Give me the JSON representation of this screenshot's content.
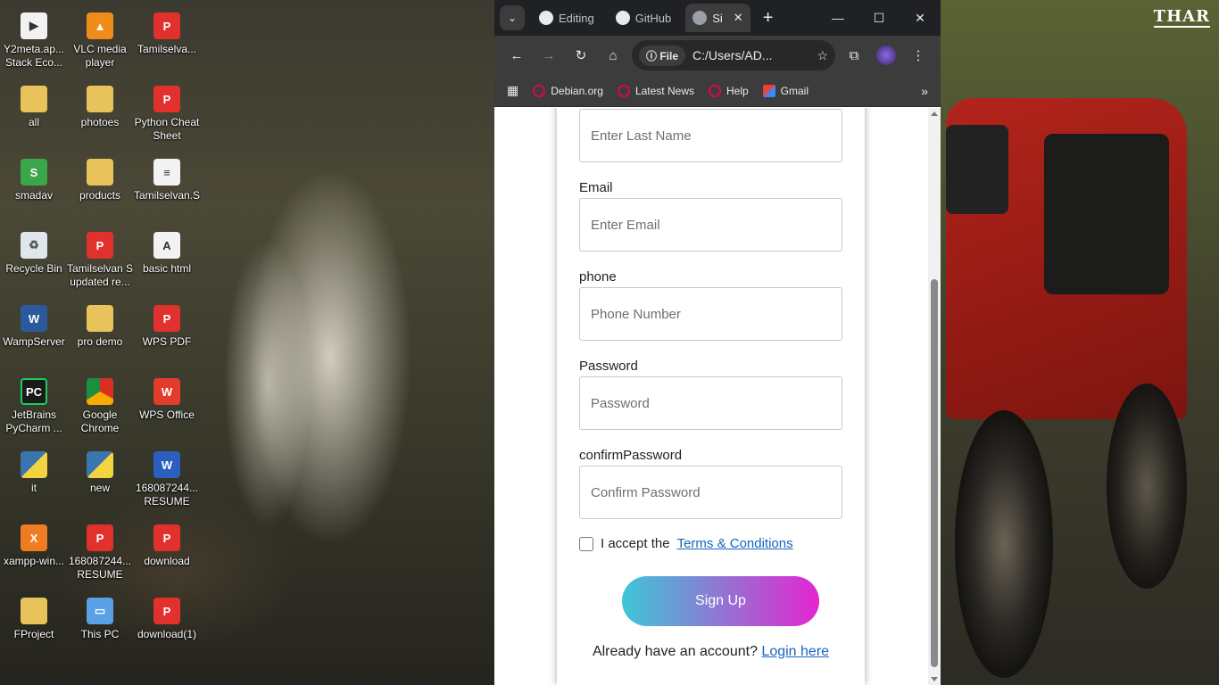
{
  "desktop": {
    "corner_logo": "THAR",
    "icons": [
      {
        "label": "Y2meta.ap... Stack Eco...",
        "icon": "video-file-icon"
      },
      {
        "label": "VLC media player",
        "icon": "vlc-icon"
      },
      {
        "label": "Tamilselva...",
        "icon": "pdf-icon"
      },
      {
        "label": "all",
        "icon": "folder-icon"
      },
      {
        "label": "photoes",
        "icon": "folder-icon"
      },
      {
        "label": "Python Cheat Sheet",
        "icon": "pdf-icon"
      },
      {
        "label": "smadav",
        "icon": "smadav-icon"
      },
      {
        "label": "products",
        "icon": "folder-icon"
      },
      {
        "label": "Tamilselvan.S",
        "icon": "text-file-icon"
      },
      {
        "label": "Recycle Bin",
        "icon": "recycle-bin-icon"
      },
      {
        "label": "Tamilselvan S updated re...",
        "icon": "pdf-icon"
      },
      {
        "label": "basic html",
        "icon": "html-file-icon"
      },
      {
        "label": "WampServer",
        "icon": "wampserver-icon"
      },
      {
        "label": "pro demo",
        "icon": "folder-icon"
      },
      {
        "label": "WPS PDF",
        "icon": "pdf-icon"
      },
      {
        "label": "JetBrains PyCharm ...",
        "icon": "pycharm-icon"
      },
      {
        "label": "Google Chrome",
        "icon": "chrome-icon"
      },
      {
        "label": "WPS Office",
        "icon": "wps-office-icon"
      },
      {
        "label": "it",
        "icon": "python-icon"
      },
      {
        "label": "new",
        "icon": "python-icon"
      },
      {
        "label": "168087244... RESUME",
        "icon": "word-icon"
      },
      {
        "label": "xampp-win...",
        "icon": "xampp-icon"
      },
      {
        "label": "168087244... RESUME",
        "icon": "pdf-icon"
      },
      {
        "label": "download",
        "icon": "pdf-icon"
      },
      {
        "label": "FProject",
        "icon": "folder-icon"
      },
      {
        "label": "This PC",
        "icon": "this-pc-icon"
      },
      {
        "label": "download(1)",
        "icon": "pdf-icon"
      }
    ]
  },
  "browser": {
    "tabs": [
      {
        "title": "Editing",
        "icon": "github-icon"
      },
      {
        "title": "GitHub",
        "icon": "chatgpt-icon"
      },
      {
        "title": "Si",
        "icon": "globe-icon",
        "active": true
      }
    ],
    "address": {
      "scheme_chip": "File",
      "url": "C:/Users/AD..."
    },
    "bookmarks": [
      {
        "label": "Debian.org",
        "icon": "debian-icon"
      },
      {
        "label": "Latest News",
        "icon": "debian-icon"
      },
      {
        "label": "Help",
        "icon": "debian-icon"
      },
      {
        "label": "Gmail",
        "icon": "gmail-icon"
      }
    ]
  },
  "form": {
    "last_name_placeholder": "Enter Last Name",
    "email_label": "Email",
    "email_placeholder": "Enter Email",
    "phone_label": "phone",
    "phone_placeholder": "Phone Number",
    "password_label": "Password",
    "password_placeholder": "Password",
    "confirm_label": "confirmPassword",
    "confirm_placeholder": "Confirm Password",
    "terms_text": "I accept the",
    "terms_link": "Terms & Conditions",
    "signup_button": "Sign Up",
    "login_prompt": "Already have an account?",
    "login_link": "Login here"
  },
  "colors": {
    "button_gradient_start": "#3ec7d8",
    "button_gradient_end": "#e425d0",
    "link": "#1565c0"
  }
}
